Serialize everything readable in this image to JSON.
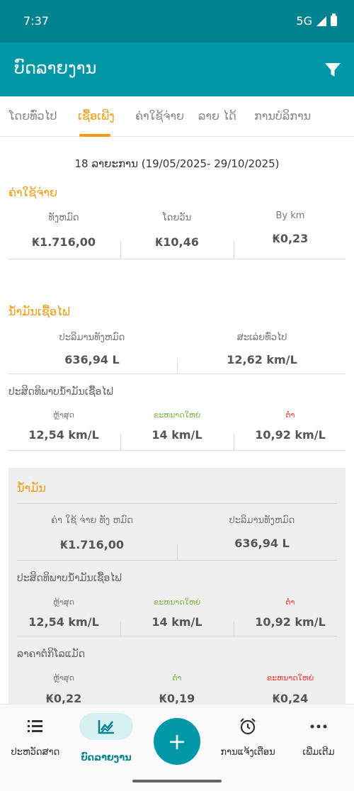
{
  "status": {
    "time": "7:37",
    "network": "5G"
  },
  "appbar": {
    "title": "ບົດລາຍງານ"
  },
  "tabs": [
    "ໂດຍທົ່ວໄປ",
    "ເຊື້ອເພີງ",
    "ຄ່າໃຊ້ຈ່າຍ",
    "ລາຍ ໄດ້",
    "ການບໍລິການ"
  ],
  "period": "18 ລາຍະການ (19/05/2025- 29/10/2025)",
  "expenses": {
    "title": "ຄ່າໃຊ້ຈ່າຍ",
    "total_label": "ທັງຫມົດ",
    "total": "₭1.716,00",
    "per_day_label": "ໂດຍວັນ",
    "per_day": "₭10,46",
    "per_km_label": "By km",
    "per_km": "₭0,23"
  },
  "fuel": {
    "title": "ນ້ຳມັນເຊື້ອໄຟ",
    "qty_label": "ປະລິມານທັງຫມົດ",
    "qty": "636,94 L",
    "avg_label": "ສະເລ່ຍທົ່ວໄປ",
    "avg": "12,62 km/L",
    "eff_label": "ປະສິດທິພາບນ້ຳມັນເຊື້ອໄຟ",
    "last_label": "ຫຼ້າສຸດ",
    "last": "12,54 km/L",
    "max_label": "ຂະຫນາດໃຫຍ່",
    "max": "14 km/L",
    "min_label": "ຕ່ຳ",
    "min": "10,92 km/L"
  },
  "oil": {
    "title": "ນ້ຳມັນ",
    "cost_label": "ຄ່າ ໃຊ້ ຈ່າຍ ທັງ ຫມົດ",
    "cost": "₭1.716,00",
    "qty_label": "ປະລິມານທັງຫມົດ",
    "qty": "636,94 L",
    "eff_label": "ປະສິດທິພາບນ້ຳມັນເຊື້ອໄຟ",
    "last_label": "ຫຼ້າສຸດ",
    "last": "12,54 km/L",
    "max_label": "ຂະຫນາດໃຫຍ່",
    "max": "14 km/L",
    "min_label": "ຕ່ຳ",
    "min": "10,92 km/L",
    "price_label": "ລາຄາຕໍ່ກິໂລແມັດ",
    "p_last_label": "ຫຼ້າສຸດ",
    "p_last": "₭0,22",
    "p_min_label": "ຕ່ຳ",
    "p_min": "₭0,19",
    "p_max_label": "ຂະຫນາດໃຫຍ່",
    "p_max": "₭0,24"
  },
  "nav": {
    "items": [
      "ປະຫວັດສາດ",
      "ບົດລາຍງານ",
      "ການແຈ້ງເຕືອນ",
      "ເພີ່ມເຕີມ"
    ],
    "fab": "+"
  },
  "colors": {
    "primary": "#0097a7",
    "dark": "#00838f",
    "accent": "#f39c12",
    "green": "#7cb342",
    "red": "#e53935"
  }
}
